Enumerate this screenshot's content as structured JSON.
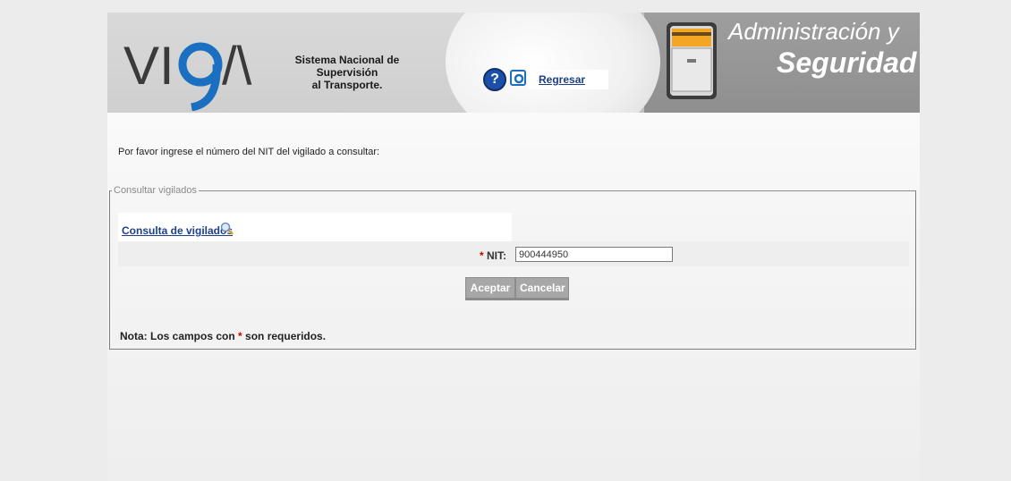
{
  "header": {
    "logo_text": "VIGIA",
    "system_name_line1": "Sistema Nacional de Supervisión",
    "system_name_line2": "al Transporte.",
    "help_icon": "question-icon",
    "back_link": "Regresar",
    "section_title_line1": "Administración y",
    "section_title_line2": "Seguridad"
  },
  "main": {
    "prompt": "Por favor ingrese el número del NIT del vigilado a consultar:",
    "fieldset_legend": "Consultar vigilados",
    "consulta_link": "Consulta de vigilados",
    "nit_required_mark": "*",
    "nit_label": "NIT:",
    "nit_value": "900444950",
    "accept_button": "Aceptar",
    "cancel_button": "Cancelar",
    "note_prefix": "Nota: Los campos con",
    "note_mark": "*",
    "note_suffix": "son requeridos."
  },
  "colors": {
    "link": "#1d3f86",
    "required": "#cc0000",
    "button": "#a7a7a7"
  }
}
